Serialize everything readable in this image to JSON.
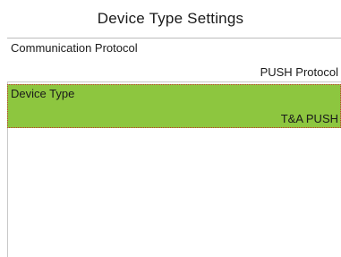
{
  "header": {
    "title": "Device Type Settings"
  },
  "menu": {
    "items": [
      {
        "label": "Communication Protocol",
        "value": "PUSH Protocol",
        "selected": false
      },
      {
        "label": "Device Type",
        "value": "T&A PUSH",
        "selected": true
      }
    ]
  },
  "colors": {
    "selected_background": "#8dc63f",
    "focus_outline": "#c0392b",
    "divider": "#c8c8c8"
  }
}
